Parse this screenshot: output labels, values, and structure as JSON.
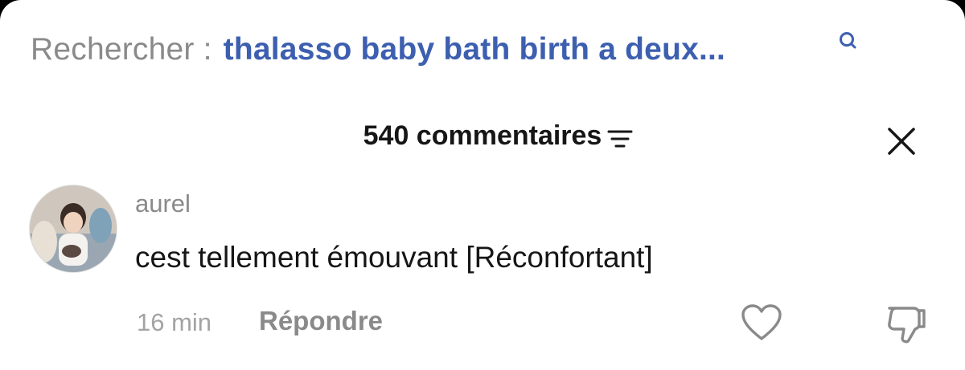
{
  "search": {
    "prefix": "Rechercher :",
    "query": "thalasso baby bath birth a deux...",
    "icon": "search-icon"
  },
  "comments_header": {
    "count_label": "540 commentaires",
    "sort_icon": "sort-lines-icon",
    "close_icon": "close-icon"
  },
  "comment": {
    "username": "aurel",
    "text": "cest tellement émouvant [Réconfortant]",
    "timestamp": "16 min",
    "reply_label": "Répondre",
    "like_icon": "heart-outline-icon",
    "dislike_icon": "thumbs-down-icon",
    "avatar_icon": "user-avatar-photo"
  },
  "colors": {
    "query_link": "#3d5fb0",
    "muted_text": "#8a8a8a",
    "primary_text": "#161616"
  }
}
